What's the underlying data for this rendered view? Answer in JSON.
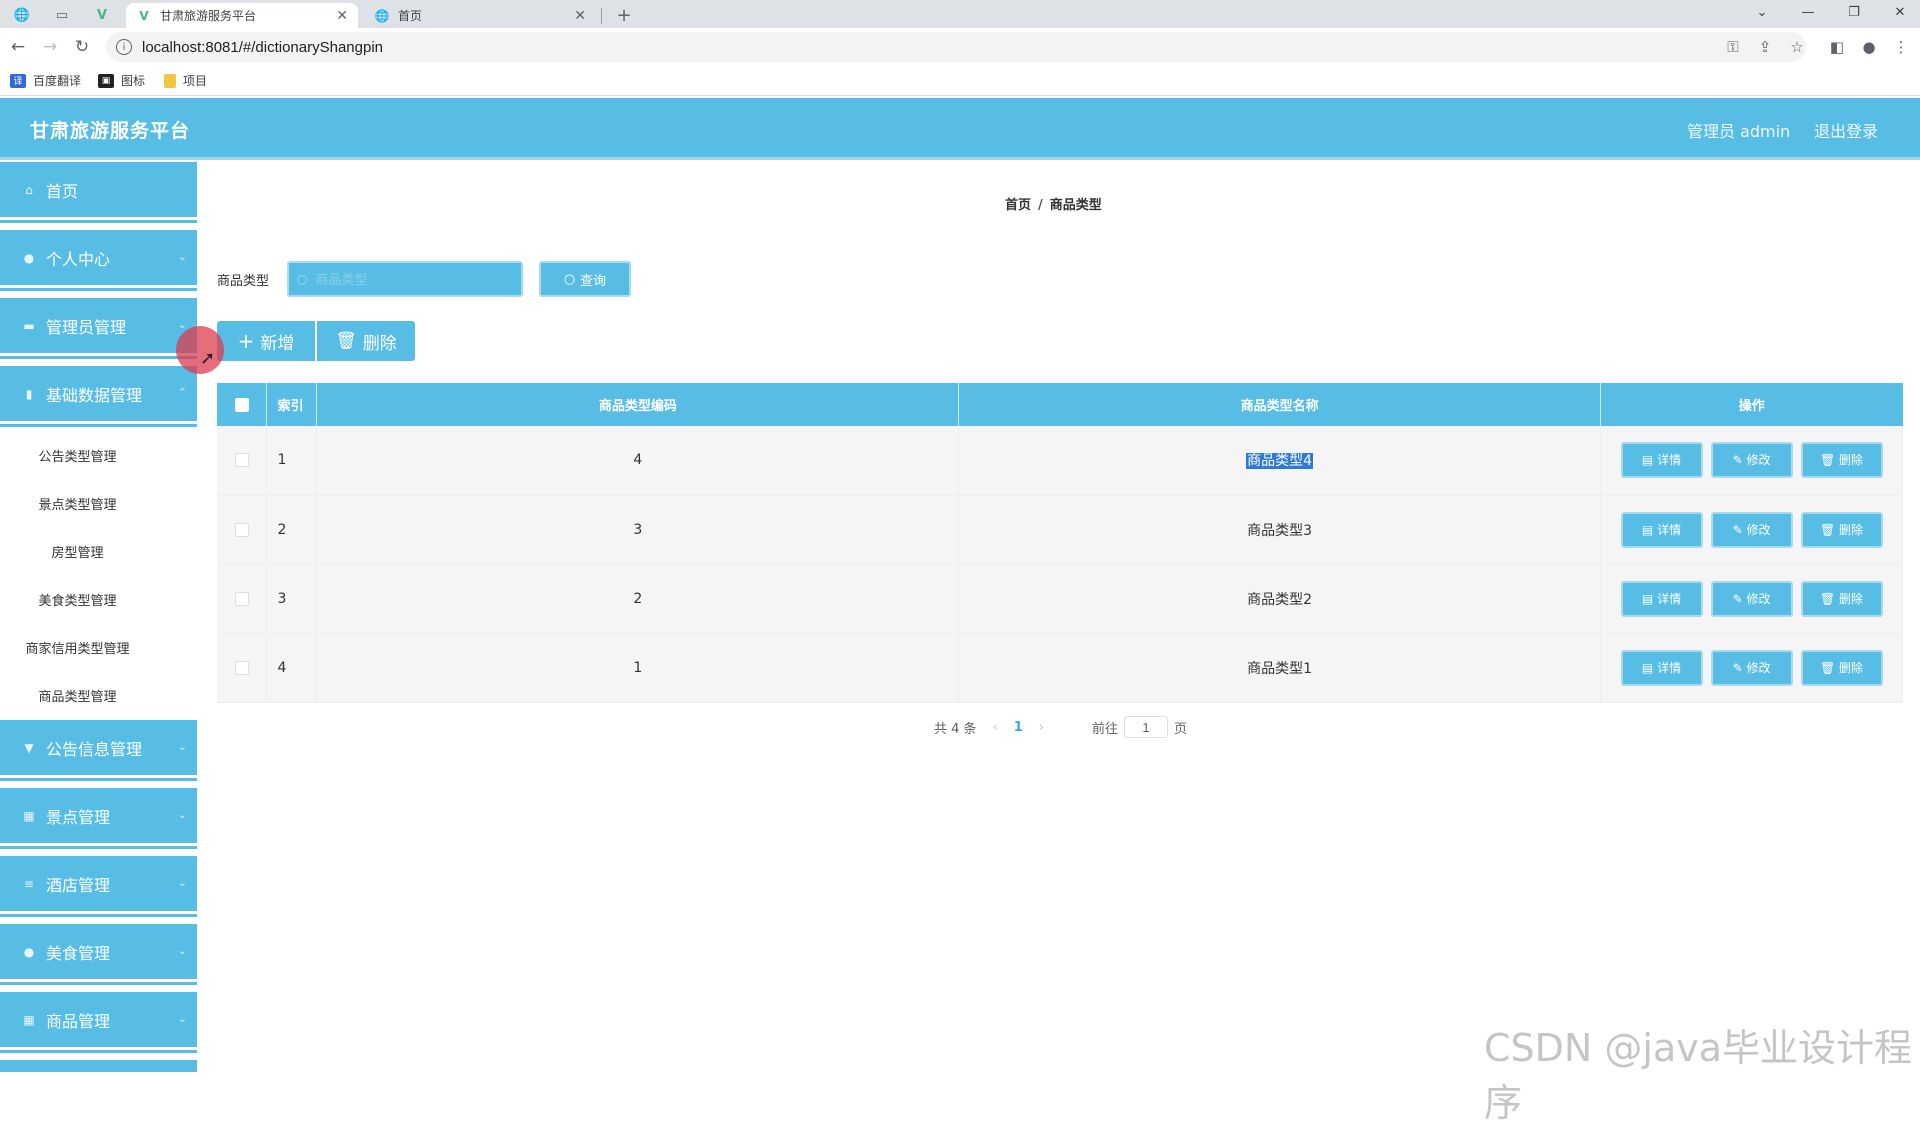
{
  "browser": {
    "tabs": [
      {
        "title": "甘肃旅游服务平台",
        "active": true
      },
      {
        "title": "首页",
        "active": false
      }
    ],
    "url": "localhost:8081/#/dictionaryShangpin",
    "bookmarks": [
      "百度翻译",
      "图标",
      "项目"
    ]
  },
  "header": {
    "title": "甘肃旅游服务平台",
    "admin": "管理员 admin",
    "logout": "退出登录"
  },
  "sidebar": {
    "items": [
      {
        "label": "首页",
        "icon": "home-icon"
      },
      {
        "label": "个人中心",
        "icon": "user-icon"
      },
      {
        "label": "管理员管理",
        "icon": "admin-icon"
      },
      {
        "label": "基础数据管理",
        "icon": "data-icon"
      },
      {
        "label": "公告信息管理",
        "icon": "notice-icon"
      },
      {
        "label": "景点管理",
        "icon": "grid-icon"
      },
      {
        "label": "酒店管理",
        "icon": "list-icon"
      },
      {
        "label": "美食管理",
        "icon": "food-icon"
      },
      {
        "label": "商品管理",
        "icon": "grid-icon"
      }
    ],
    "sub_items": [
      "公告类型管理",
      "景点类型管理",
      "房型管理",
      "美食类型管理",
      "商家信用类型管理",
      "商品类型管理"
    ]
  },
  "breadcrumb": {
    "home": "首页",
    "sep": "/",
    "current": "商品类型"
  },
  "search": {
    "label": "商品类型",
    "placeholder": "商品类型",
    "button": "查询"
  },
  "actions": {
    "add": "新增",
    "delete": "删除"
  },
  "table": {
    "columns": [
      "索引",
      "商品类型编码",
      "商品类型名称",
      "操作"
    ],
    "rows": [
      {
        "index": "1",
        "code": "4",
        "name": "商品类型4"
      },
      {
        "index": "2",
        "code": "3",
        "name": "商品类型3"
      },
      {
        "index": "3",
        "code": "2",
        "name": "商品类型2"
      },
      {
        "index": "4",
        "code": "1",
        "name": "商品类型1"
      }
    ],
    "row_buttons": {
      "detail": "详情",
      "edit": "修改",
      "delete": "删除"
    }
  },
  "pagination": {
    "total": "共 4 条",
    "current": "1",
    "goto": "前往",
    "page_value": "1",
    "page_unit": "页"
  },
  "watermark": "CSDN @java毕业设计程序"
}
